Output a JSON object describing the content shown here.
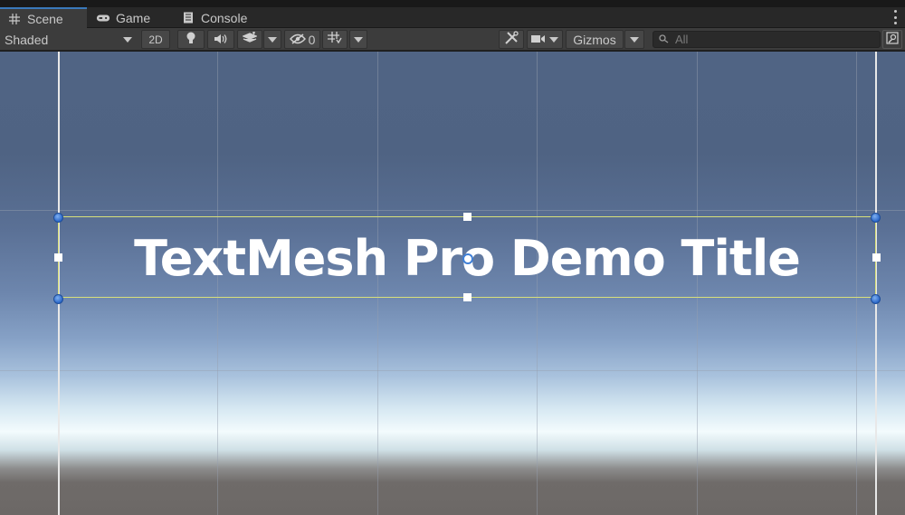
{
  "tabs": [
    {
      "label": "Scene",
      "icon": "grid-icon",
      "active": true
    },
    {
      "label": "Game",
      "icon": "gamepad-icon",
      "active": false
    },
    {
      "label": "Console",
      "icon": "console-icon",
      "active": false
    }
  ],
  "toolbar": {
    "draw_mode": "Shaded",
    "mode_2d": "2D",
    "hidden_count": "0",
    "gizmos_label": "Gizmos",
    "search_placeholder": "All"
  },
  "scene": {
    "title_text": "TextMesh Pro Demo Title"
  },
  "colors": {
    "accent": "#3a79bb",
    "rect_outline": "#d8e07a"
  }
}
